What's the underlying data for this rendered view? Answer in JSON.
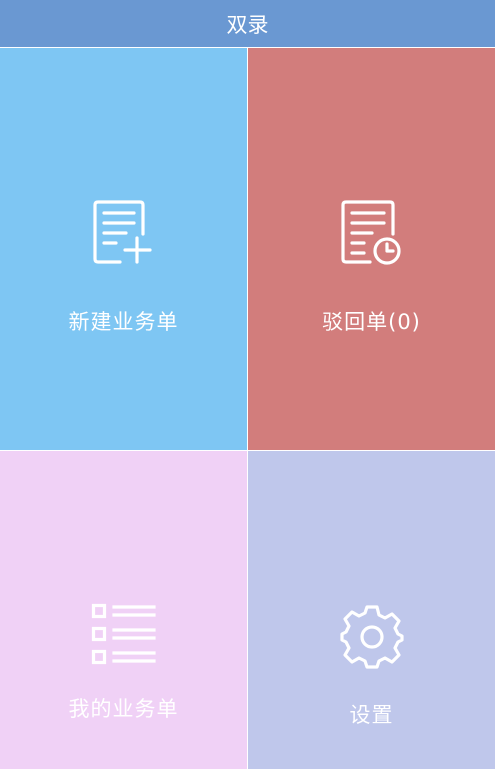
{
  "header": {
    "title": "双录"
  },
  "tiles": [
    {
      "label": "新建业务单",
      "icon": "document-add-icon",
      "color": "#7ec6f3"
    },
    {
      "label": "驳回单(0)",
      "icon": "document-clock-icon",
      "color": "#d27d7c"
    },
    {
      "label": "我的业务单",
      "icon": "list-icon",
      "color": "#f0d1f6"
    },
    {
      "label": "设置",
      "icon": "gear-icon",
      "color": "#bfc7eb"
    }
  ],
  "colors": {
    "header_bg": "#6a98d2",
    "text": "#ffffff"
  }
}
